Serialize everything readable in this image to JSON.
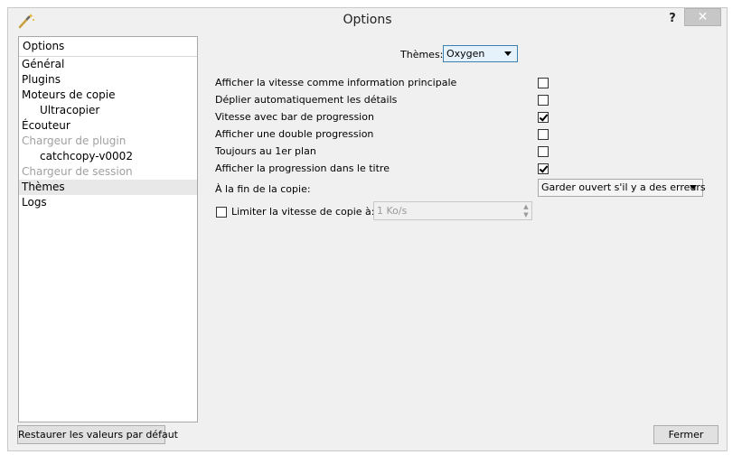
{
  "window": {
    "title": "Options",
    "help_label": "?",
    "close_label": "✕"
  },
  "sidebar": {
    "header": "Options",
    "items": [
      {
        "label": "Général",
        "indent": false,
        "disabled": false,
        "selected": false
      },
      {
        "label": "Plugins",
        "indent": false,
        "disabled": false,
        "selected": false
      },
      {
        "label": "Moteurs de copie",
        "indent": false,
        "disabled": false,
        "selected": false
      },
      {
        "label": "Ultracopier",
        "indent": true,
        "disabled": false,
        "selected": false
      },
      {
        "label": "Écouteur",
        "indent": false,
        "disabled": false,
        "selected": false
      },
      {
        "label": "Chargeur de plugin",
        "indent": false,
        "disabled": true,
        "selected": false
      },
      {
        "label": "catchcopy-v0002",
        "indent": true,
        "disabled": false,
        "selected": false
      },
      {
        "label": "Chargeur de session",
        "indent": false,
        "disabled": true,
        "selected": false
      },
      {
        "label": "Thèmes",
        "indent": false,
        "disabled": false,
        "selected": true
      },
      {
        "label": "Logs",
        "indent": false,
        "disabled": false,
        "selected": false
      }
    ]
  },
  "themes": {
    "label": "Thèmes:",
    "value": "Oxygen"
  },
  "options": [
    {
      "label": "Afficher la vitesse comme information principale",
      "checked": false
    },
    {
      "label": "Déplier automatiquement les détails",
      "checked": false
    },
    {
      "label": "Vitesse avec bar de progression",
      "checked": true
    },
    {
      "label": "Afficher une double progression",
      "checked": false
    },
    {
      "label": "Toujours au 1er plan",
      "checked": false
    },
    {
      "label": "Afficher la progression dans le titre",
      "checked": true
    }
  ],
  "end_of_copy": {
    "label": "À la fin de la copie:",
    "value": "Garder ouvert s'il y a des erreurs"
  },
  "speed_limit": {
    "label": "Limiter la vitesse de copie à:",
    "checked": false,
    "value": "1 Ko/s"
  },
  "buttons": {
    "restore": "Restaurer les valeurs par défaut",
    "close": "Fermer"
  }
}
